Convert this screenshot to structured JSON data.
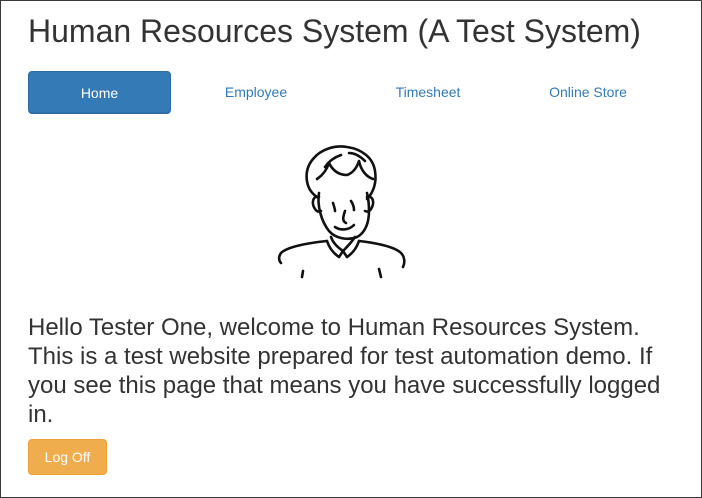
{
  "header": {
    "title": "Human Resources System (A Test System)"
  },
  "nav": {
    "items": [
      {
        "label": "Home",
        "active": true
      },
      {
        "label": "Employee",
        "active": false
      },
      {
        "label": "Timesheet",
        "active": false
      },
      {
        "label": "Online Store",
        "active": false
      }
    ]
  },
  "main": {
    "avatar_icon": "user-avatar-sketch",
    "welcome_text": "Hello Tester One, welcome to Human Resources System. This is a test website prepared for test automation demo. If you see this page that means you have successfully logged in.",
    "logoff_label": "Log Off"
  },
  "colors": {
    "primary": "#337ab7",
    "warning": "#f0ad4e",
    "text": "#333333"
  }
}
